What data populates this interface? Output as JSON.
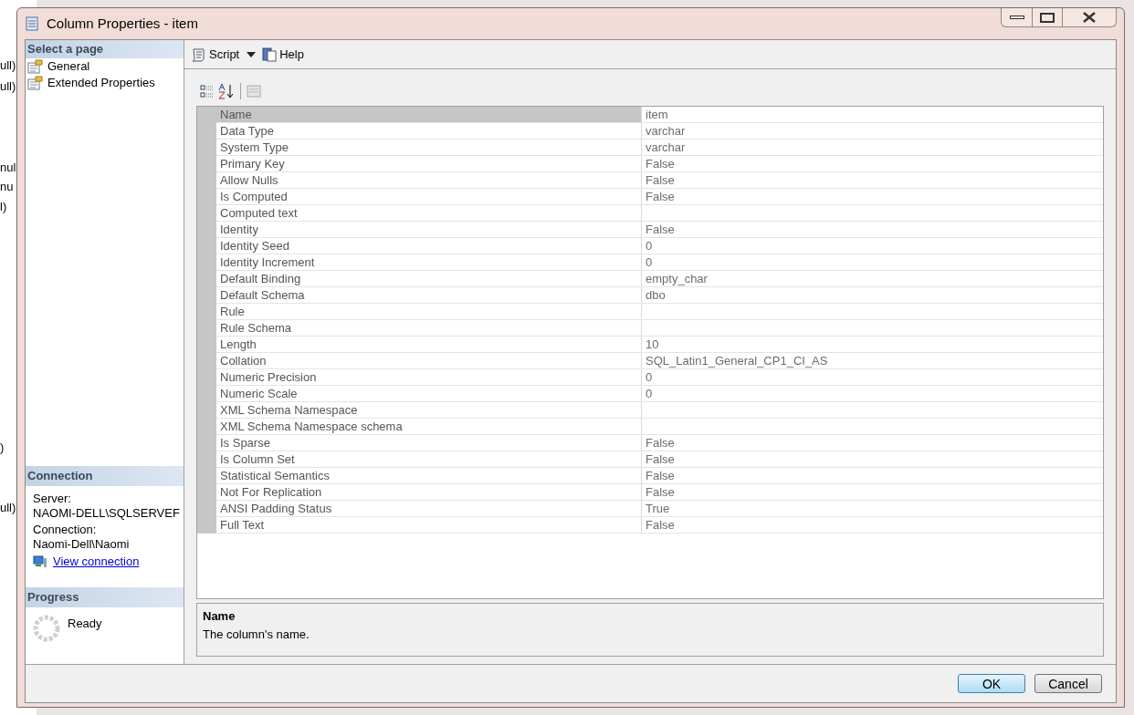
{
  "background_fragments": [
    "ull)",
    "ull)",
    "nul",
    "nu",
    "l)",
    ")",
    "ull)"
  ],
  "window": {
    "title": "Column Properties - item"
  },
  "sidebar": {
    "header": "Select a page",
    "pages": [
      {
        "label": "General"
      },
      {
        "label": "Extended Properties"
      }
    ]
  },
  "connection": {
    "header": "Connection",
    "server_label": "Server:",
    "server": "NAOMI-DELL\\SQLSERVEF",
    "connection_label": "Connection:",
    "connection": "Naomi-Dell\\Naomi",
    "link": "View connection"
  },
  "progress": {
    "header": "Progress",
    "status": "Ready"
  },
  "toolbar": {
    "script": "Script",
    "help": "Help"
  },
  "properties": [
    {
      "name": "Name",
      "value": "item",
      "selected": true
    },
    {
      "name": "Data Type",
      "value": "varchar",
      "selected": false
    },
    {
      "name": "System Type",
      "value": "varchar",
      "selected": false
    },
    {
      "name": "Primary Key",
      "value": "False",
      "selected": false
    },
    {
      "name": "Allow Nulls",
      "value": "False",
      "selected": false
    },
    {
      "name": "Is Computed",
      "value": "False",
      "selected": false
    },
    {
      "name": "Computed text",
      "selected": false
    },
    {
      "name": "Identity",
      "value": "False",
      "selected": false
    },
    {
      "name": "Identity Seed",
      "value": "0",
      "selected": false
    },
    {
      "name": "Identity Increment",
      "value": "0",
      "selected": false
    },
    {
      "name": "Default Binding",
      "value": "empty_char",
      "selected": false
    },
    {
      "name": "Default Schema",
      "value": "dbo",
      "selected": false
    },
    {
      "name": "Rule",
      "selected": false
    },
    {
      "name": "Rule Schema",
      "selected": false
    },
    {
      "name": "Length",
      "value": "10",
      "selected": false
    },
    {
      "name": "Collation",
      "value": "SQL_Latin1_General_CP1_CI_AS",
      "selected": false
    },
    {
      "name": "Numeric Precision",
      "value": "0",
      "selected": false
    },
    {
      "name": "Numeric Scale",
      "value": "0",
      "selected": false
    },
    {
      "name": "XML Schema Namespace",
      "selected": false
    },
    {
      "name": "XML Schema Namespace schema",
      "selected": false
    },
    {
      "name": "Is Sparse",
      "value": "False",
      "selected": false
    },
    {
      "name": "Is Column Set",
      "value": "False",
      "selected": false
    },
    {
      "name": "Statistical Semantics",
      "value": "False",
      "selected": false
    },
    {
      "name": "Not For Replication",
      "value": "False",
      "selected": false
    },
    {
      "name": "ANSI Padding Status",
      "value": "True",
      "selected": false
    },
    {
      "name": "Full Text",
      "value": "False",
      "selected": false
    }
  ],
  "description": {
    "title": "Name",
    "text": "The column's name."
  },
  "buttons": [
    {
      "label": "OK",
      "kind": "default"
    },
    {
      "label": "Cancel",
      "kind": "normal"
    }
  ]
}
